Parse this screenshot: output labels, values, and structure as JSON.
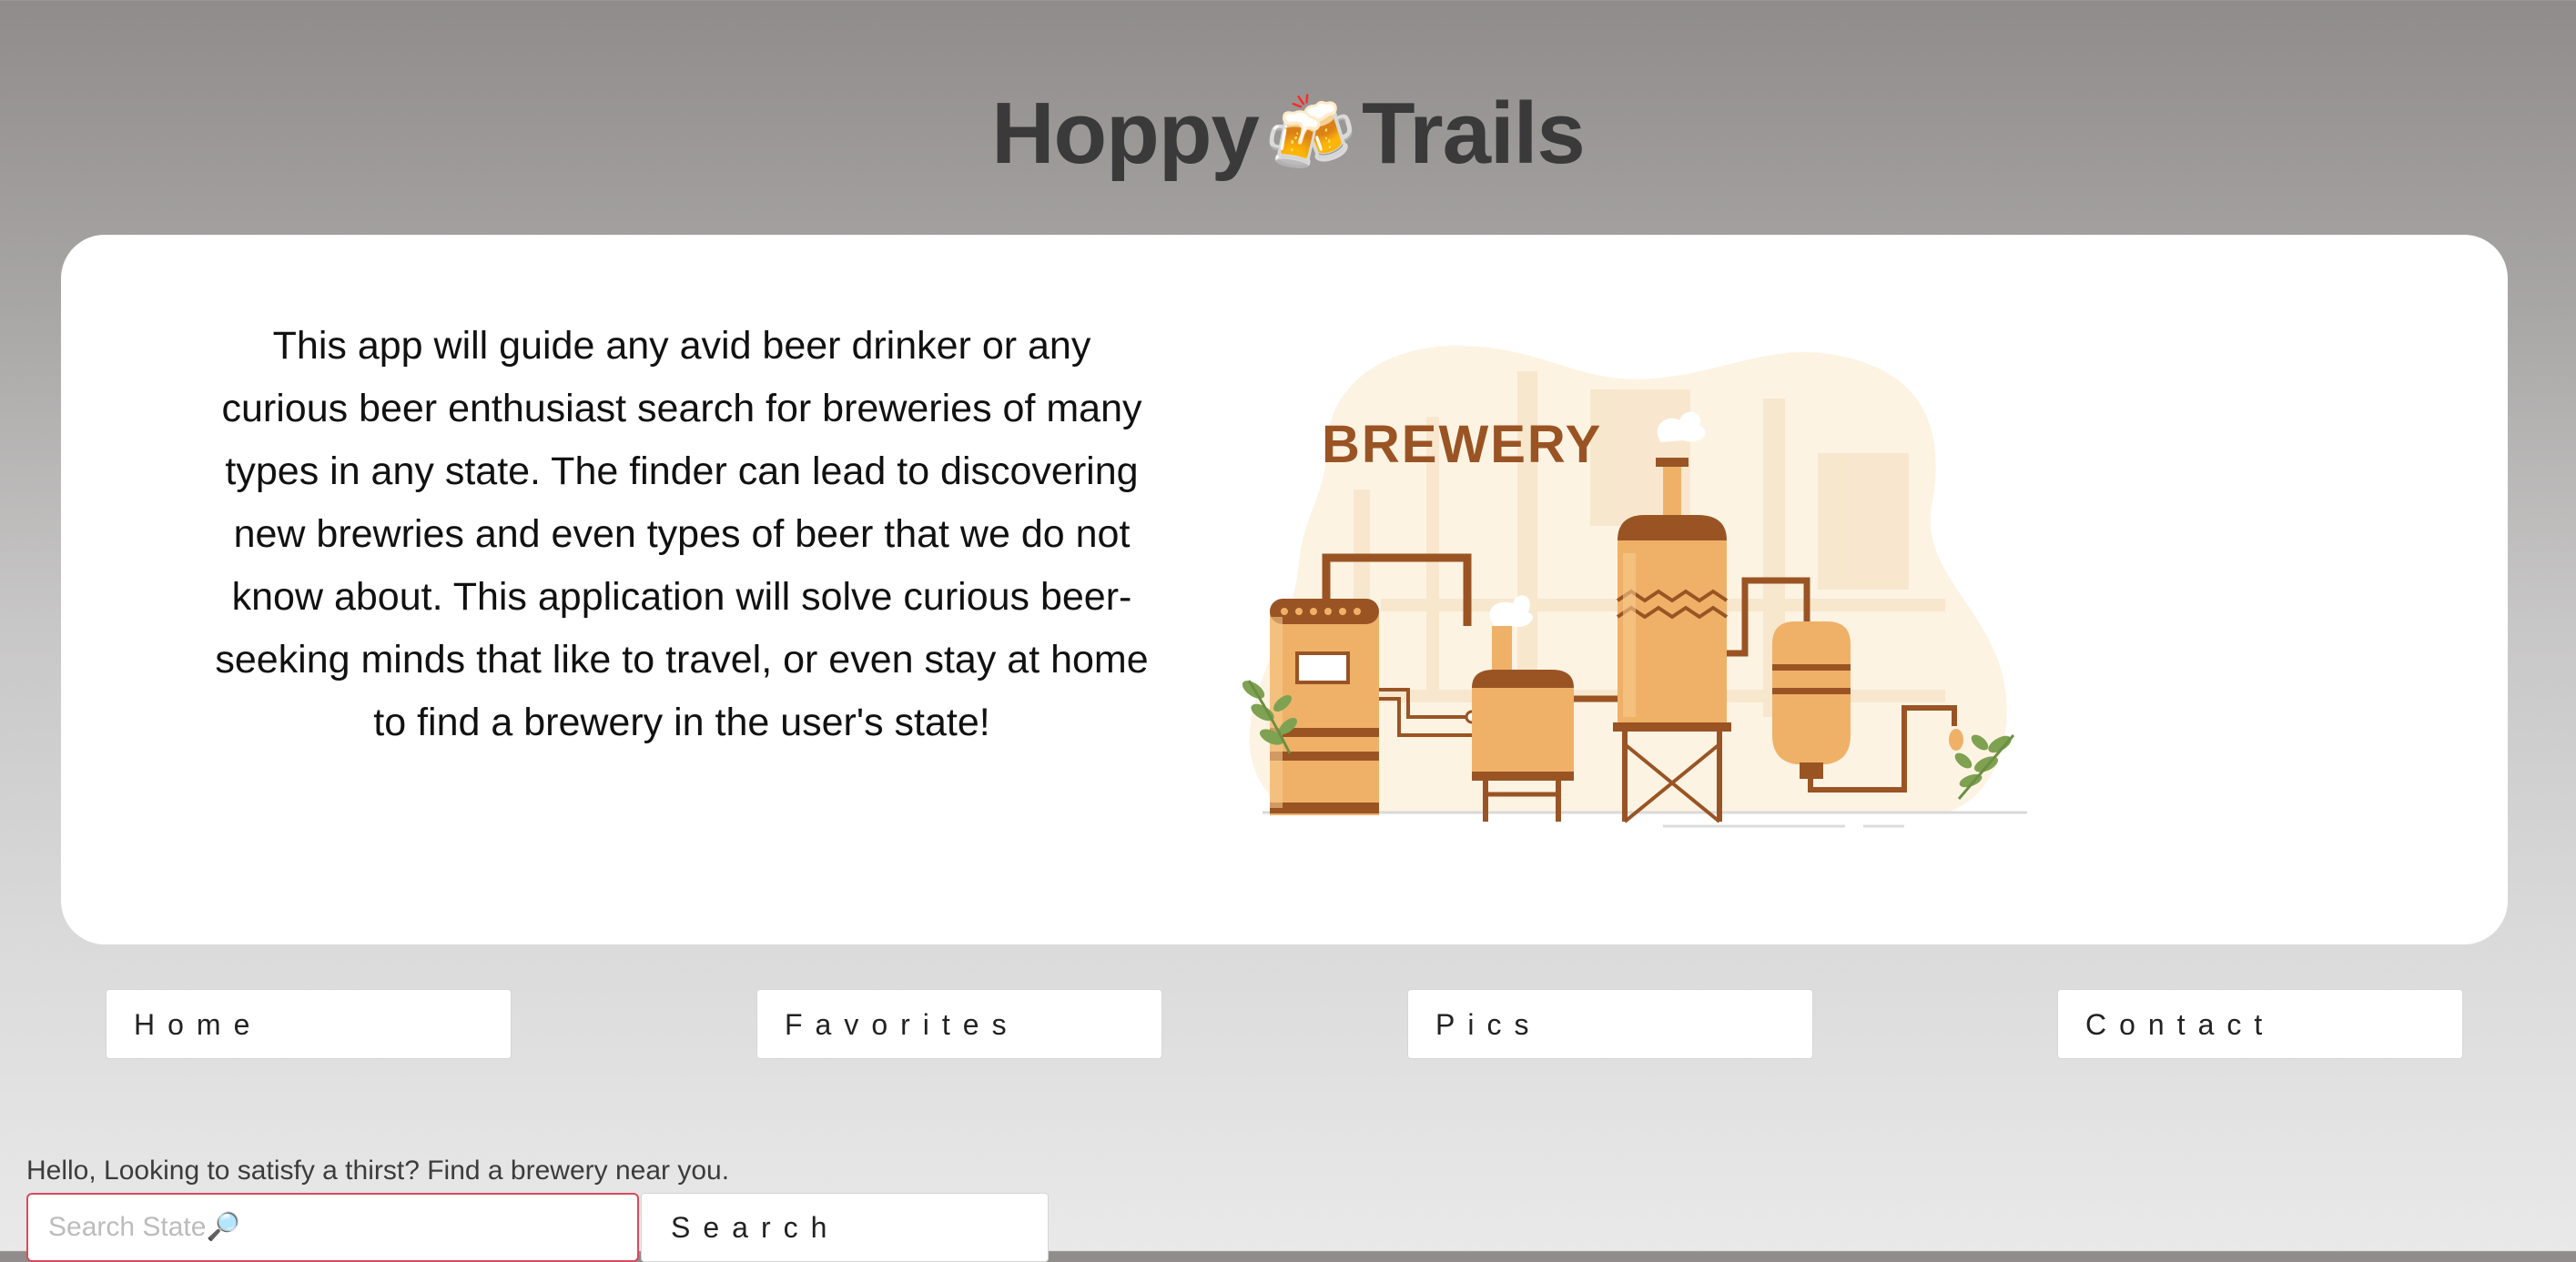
{
  "header": {
    "title_left": "Hoppy",
    "title_icon": "🍻",
    "title_right": "Trails"
  },
  "intro": {
    "description": "This app will guide any avid beer drinker or any curious beer enthusiast search for breweries of many types in any state. The finder can lead to discovering new brewries and even types of beer that we do not know about. This application will solve curious beer-seeking minds that like to travel, or even stay at home to find a brewery in the user's state!",
    "illustration_label": "BREWERY"
  },
  "nav": {
    "items": [
      {
        "label": "Home"
      },
      {
        "label": "Favorites"
      },
      {
        "label": "Pics"
      },
      {
        "label": "Contact"
      }
    ]
  },
  "search": {
    "greeting": "Hello, Looking to satisfy a thirst? Find a brewery near you.",
    "placeholder": "Search State🔎",
    "value": "",
    "button_label": "Search"
  },
  "colors": {
    "accent_border": "#d94a5c",
    "brewery_brown": "#9a5424",
    "tank_orange": "#efb168"
  }
}
